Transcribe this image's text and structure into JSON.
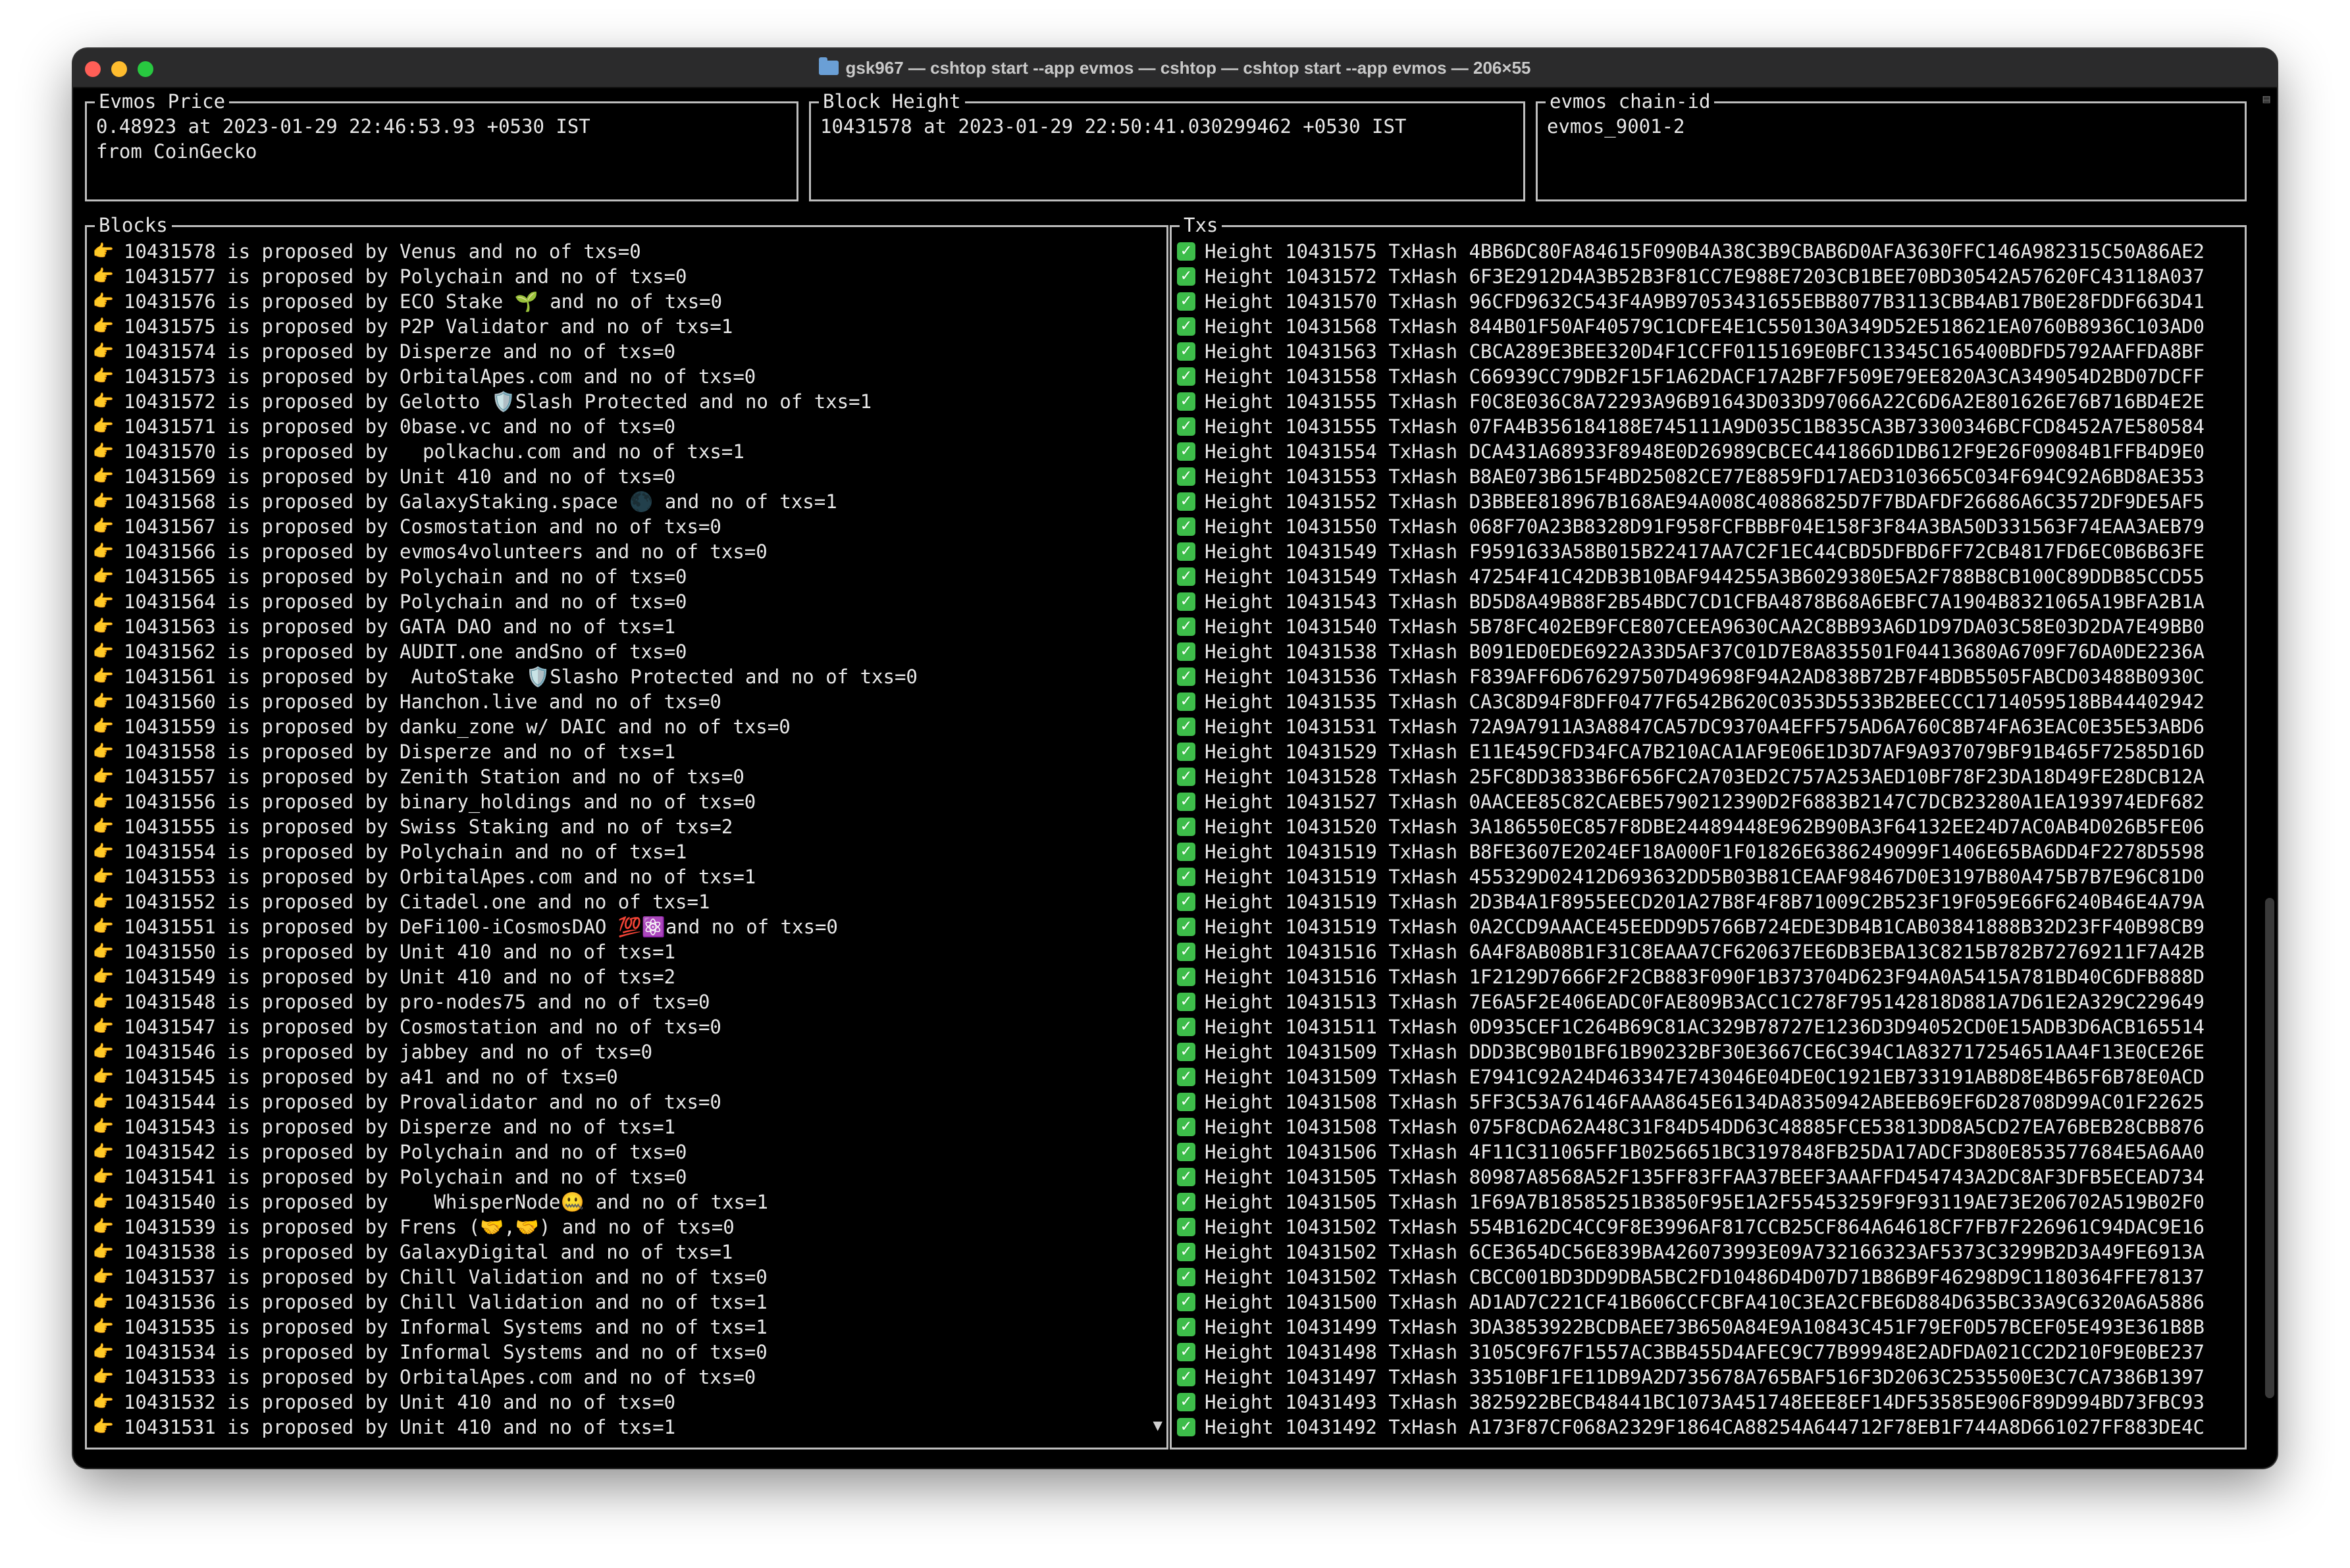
{
  "window": {
    "title": "gsk967 — cshtop start --app evmos — cshtop — cshtop start --app evmos — 206×55"
  },
  "panels": {
    "price": {
      "title": "Evmos Price",
      "line1": "0.48923 at 2023-01-29 22:46:53.93 +0530 IST",
      "line2": "from CoinGecko"
    },
    "height": {
      "title": "Block Height",
      "line1": "10431578 at 2023-01-29 22:50:41.030299462 +0530 IST"
    },
    "chain": {
      "title": "evmos chain-id",
      "line1": "evmos_9001-2"
    },
    "blocks": {
      "title": "Blocks",
      "icon": "pointing-hand-icon",
      "more_indicator": "▼",
      "rows": [
        "10431578 is proposed by Venus and no of txs=0",
        "10431577 is proposed by Polychain and no of txs=0",
        "10431576 is proposed by ECO Stake 🌱 and no of txs=0",
        "10431575 is proposed by P2P Validator and no of txs=1",
        "10431574 is proposed by Disperze and no of txs=0",
        "10431573 is proposed by OrbitalApes.com and no of txs=0",
        "10431572 is proposed by Gelotto 🛡️Slash Protected and no of txs=1",
        "10431571 is proposed by 0base.vc and no of txs=0",
        "10431570 is proposed by   polkachu.com and no of txs=1",
        "10431569 is proposed by Unit 410 and no of txs=0",
        "10431568 is proposed by GalaxyStaking.space 🌑 and no of txs=1",
        "10431567 is proposed by Cosmostation and no of txs=0",
        "10431566 is proposed by evmos4volunteers and no of txs=0",
        "10431565 is proposed by Polychain and no of txs=0",
        "10431564 is proposed by Polychain and no of txs=0",
        "10431563 is proposed by GATA DAO and no of txs=1",
        "10431562 is proposed by AUDIT.one andSno of txs=0",
        "10431561 is proposed by  AutoStake 🛡️Slasho Protected and no of txs=0",
        "10431560 is proposed by Hanchon.live and no of txs=0",
        "10431559 is proposed by danku_zone w/ DAIC and no of txs=0",
        "10431558 is proposed by Disperze and no of txs=1",
        "10431557 is proposed by Zenith Station and no of txs=0",
        "10431556 is proposed by binary_holdings and no of txs=0",
        "10431555 is proposed by Swiss Staking and no of txs=2",
        "10431554 is proposed by Polychain and no of txs=1",
        "10431553 is proposed by OrbitalApes.com and no of txs=1",
        "10431552 is proposed by Citadel.one and no of txs=1",
        "10431551 is proposed by DeFi100-iCosmosDAO 💯⚛️and no of txs=0",
        "10431550 is proposed by Unit 410 and no of txs=1",
        "10431549 is proposed by Unit 410 and no of txs=2",
        "10431548 is proposed by pro-nodes75 and no of txs=0",
        "10431547 is proposed by Cosmostation and no of txs=0",
        "10431546 is proposed by jabbey and no of txs=0",
        "10431545 is proposed by a41 and no of txs=0",
        "10431544 is proposed by Provalidator and no of txs=0",
        "10431543 is proposed by Disperze and no of txs=1",
        "10431542 is proposed by Polychain and no of txs=0",
        "10431541 is proposed by Polychain and no of txs=0",
        "10431540 is proposed by    WhisperNode🤐 and no of txs=1",
        "10431539 is proposed by Frens (🤝,🤝) and no of txs=0",
        "10431538 is proposed by GalaxyDigital and no of txs=1",
        "10431537 is proposed by Chill Validation and no of txs=0",
        "10431536 is proposed by Chill Validation and no of txs=1",
        "10431535 is proposed by Informal Systems and no of txs=1",
        "10431534 is proposed by Informal Systems and no of txs=0",
        "10431533 is proposed by OrbitalApes.com and no of txs=0",
        "10431532 is proposed by Unit 410 and no of txs=0",
        "10431531 is proposed by Unit 410 and no of txs=1"
      ]
    },
    "txs": {
      "title": "Txs",
      "icon": "check-mark-icon",
      "check_glyph": "✓",
      "rows": [
        "Height 10431575 TxHash 4BB6DC80FA84615F090B4A38C3B9CBAB6D0AFA3630FFC146A982315C50A86AE2",
        "Height 10431572 TxHash 6F3E2912D4A3B52B3F81CC7E988E7203CB1BEE70BD30542A57620FC43118A037",
        "Height 10431570 TxHash 96CFD9632C543F4A9B97053431655EBB8077B3113CBB4AB17B0E28FDDF663D41",
        "Height 10431568 TxHash 844B01F50AF40579C1CDFE4E1C550130A349D52E518621EA0760B8936C103AD0",
        "Height 10431563 TxHash CBCA289E3BEE320D4F1CCFF0115169E0BFC13345C165400BDFD5792AAFFDA8BF",
        "Height 10431558 TxHash C66939CC79DB2F15F1A62DACF17A2BF7F509E79EE820A3CA349054D2BD07DCFF",
        "Height 10431555 TxHash F0C8E036C8A72293A96B91643D033D97066A22C6D6A2E801626E76B716BD4E2E",
        "Height 10431555 TxHash 07FA4B356184188E745111A9D035C1B835CA3B73300346BCFCD8452A7E580584",
        "Height 10431554 TxHash DCA431A68933F8948E0D26989CBCEC441866D1DB612F9E26F09084B1FFB4D9E0",
        "Height 10431553 TxHash B8AE073B615F4BD25082CE77E8859FD17AED3103665C034F694C92A6BD8AE353",
        "Height 10431552 TxHash D3BBEE818967B168AE94A008C40886825D7F7BDAFDF26686A6C3572DF9DE5AF5",
        "Height 10431550 TxHash 068F70A23B8328D91F958FCFBBBF04E158F3F84A3BA50D331563F74EAA3AEB79",
        "Height 10431549 TxHash F9591633A58B015B22417AA7C2F1EC44CBD5DFBD6FF72CB4817FD6EC0B6B63FE",
        "Height 10431549 TxHash 47254F41C42DB3B10BAF944255A3B6029380E5A2F788B8CB100C89DDB85CCD55",
        "Height 10431543 TxHash BD5D8A49B88F2B54BDC7CD1CFBA4878B68A6EBFC7A1904B8321065A19BFA2B1A",
        "Height 10431540 TxHash 5B78FC402EB9FCE807CEEA9630CAA2C8BB93A6D1D97DA03C58E03D2DA7E49BB0",
        "Height 10431538 TxHash B091ED0EDE6922A33D5AF37C01D7E8A835501F04413680A6709F76DA0DE2236A",
        "Height 10431536 TxHash F839AFF6D676297507D49698F94A2AD838B72B7F4BDB5505FABCD03488B0930C",
        "Height 10431535 TxHash CA3C8D94F8DFF0477F6542B620C0353D5533B2BEECCC1714059518BB44402942",
        "Height 10431531 TxHash 72A9A7911A3A8847CA57DC9370A4EFF575AD6A760C8B74FA63EAC0E35E53ABD6",
        "Height 10431529 TxHash E11E459CFD34FCA7B210ACA1AF9E06E1D3D7AF9A937079BF91B465F72585D16D",
        "Height 10431528 TxHash 25FC8DD3833B6F656FC2A703ED2C757A253AED10BF78F23DA18D49FE28DCB12A",
        "Height 10431527 TxHash 0AACEE85C82CAEBE5790212390D2F6883B2147C7DCB23280A1EA193974EDF682",
        "Height 10431520 TxHash 3A186550EC857F8DBE24489448E962B90BA3F64132EE24D7AC0AB4D026B5FE06",
        "Height 10431519 TxHash B8FE3607E2024EF18A000F1F01826E6386249099F1406E65BA6DD4F2278D5598",
        "Height 10431519 TxHash 455329D02412D693632DD5B03B81CEAAF98467D0E3197B80A475B7B7E96C81D0",
        "Height 10431519 TxHash 2D3B4A1F8955EECD201A27B8F4F8B71009C2B523F19F059E66F6240B46E4A79A",
        "Height 10431519 TxHash 0A2CCD9AAACE45EEDD9D5766B724EDE3DB4B1CAB03841888B32D23FF40B98CB9",
        "Height 10431516 TxHash 6A4F8AB08B1F31C8EAAA7CF620637EE6DB3EBA13C8215B782B72769211F7A42B",
        "Height 10431516 TxHash 1F2129D7666F2F2CB883F090F1B373704D623F94A0A5415A781BD40C6DFB888D",
        "Height 10431513 TxHash 7E6A5F2E406EADC0FAE809B3ACC1C278F795142818D881A7D61E2A329C229649",
        "Height 10431511 TxHash 0D935CEF1C264B69C81AC329B78727E1236D3D94052CD0E15ADB3D6ACB165514",
        "Height 10431509 TxHash DDD3BC9B01BF61B90232BF30E3667CE6C394C1A832717254651AA4F13E0CE26E",
        "Height 10431509 TxHash E7941C92A24D463347E743046E04DE0C1921EB733191AB8D8E4B65F6B78E0ACD",
        "Height 10431508 TxHash 5FF3C53A76146FAAA8645E6134DA8350942ABEEB69EF6D28708D99AC01F22625",
        "Height 10431508 TxHash 075F8CDA62A48C31F84D54DD63C48885FCE53813DD8A5CD27EA76BEB28CBB876",
        "Height 10431506 TxHash 4F11C311065FF1B0256651BC3197848FB25DA17ADCF3D80E853577684E5A6AA0",
        "Height 10431505 TxHash 80987A8568A52F135FF83FFAA37BEEF3AAAFFD454743A2DC8AF3DFB5ECEAD734",
        "Height 10431505 TxHash 1F69A7B18585251B3850F95E1A2F55453259F9F93119AE73E206702A519B02F0",
        "Height 10431502 TxHash 554B162DC4CC9F8E3996AF817CCB25CF864A64618CF7FB7F226961C94DAC9E16",
        "Height 10431502 TxHash 6CE3654DC56E839BA426073993E09A732166323AF5373C3299B2D3A49FE6913A",
        "Height 10431502 TxHash CBCC001BD3DD9DBA5BC2FD10486D4D07D71B86B9F46298D9C1180364FFE78137",
        "Height 10431500 TxHash AD1AD7C221CF41B606CCFCBFA410C3EA2CFBE6D884D635BC33A9C6320A6A5886",
        "Height 10431499 TxHash 3DA3853922BCDBAEE73B650A84E9A10843C451F79EF0D57BCEF05E493E361B8B",
        "Height 10431498 TxHash 3105C9F67F1557AC3BB455D4AFEC9C77B99948E2ADFDA021CC2D210F9E0BE237",
        "Height 10431497 TxHash 33510BF1FE11DB9A2D735678A765BAF516F3D2063C2535500E3C7CA7386B1397",
        "Height 10431493 TxHash 3825922BECB48441BC1073A451748EEE8EF14DF53585E906F89D994BD73FBC93",
        "Height 10431492 TxHash A173F87CF068A2329F1864CA88254A644712F78EB1F744A8D661027FF883DE4C"
      ]
    }
  }
}
